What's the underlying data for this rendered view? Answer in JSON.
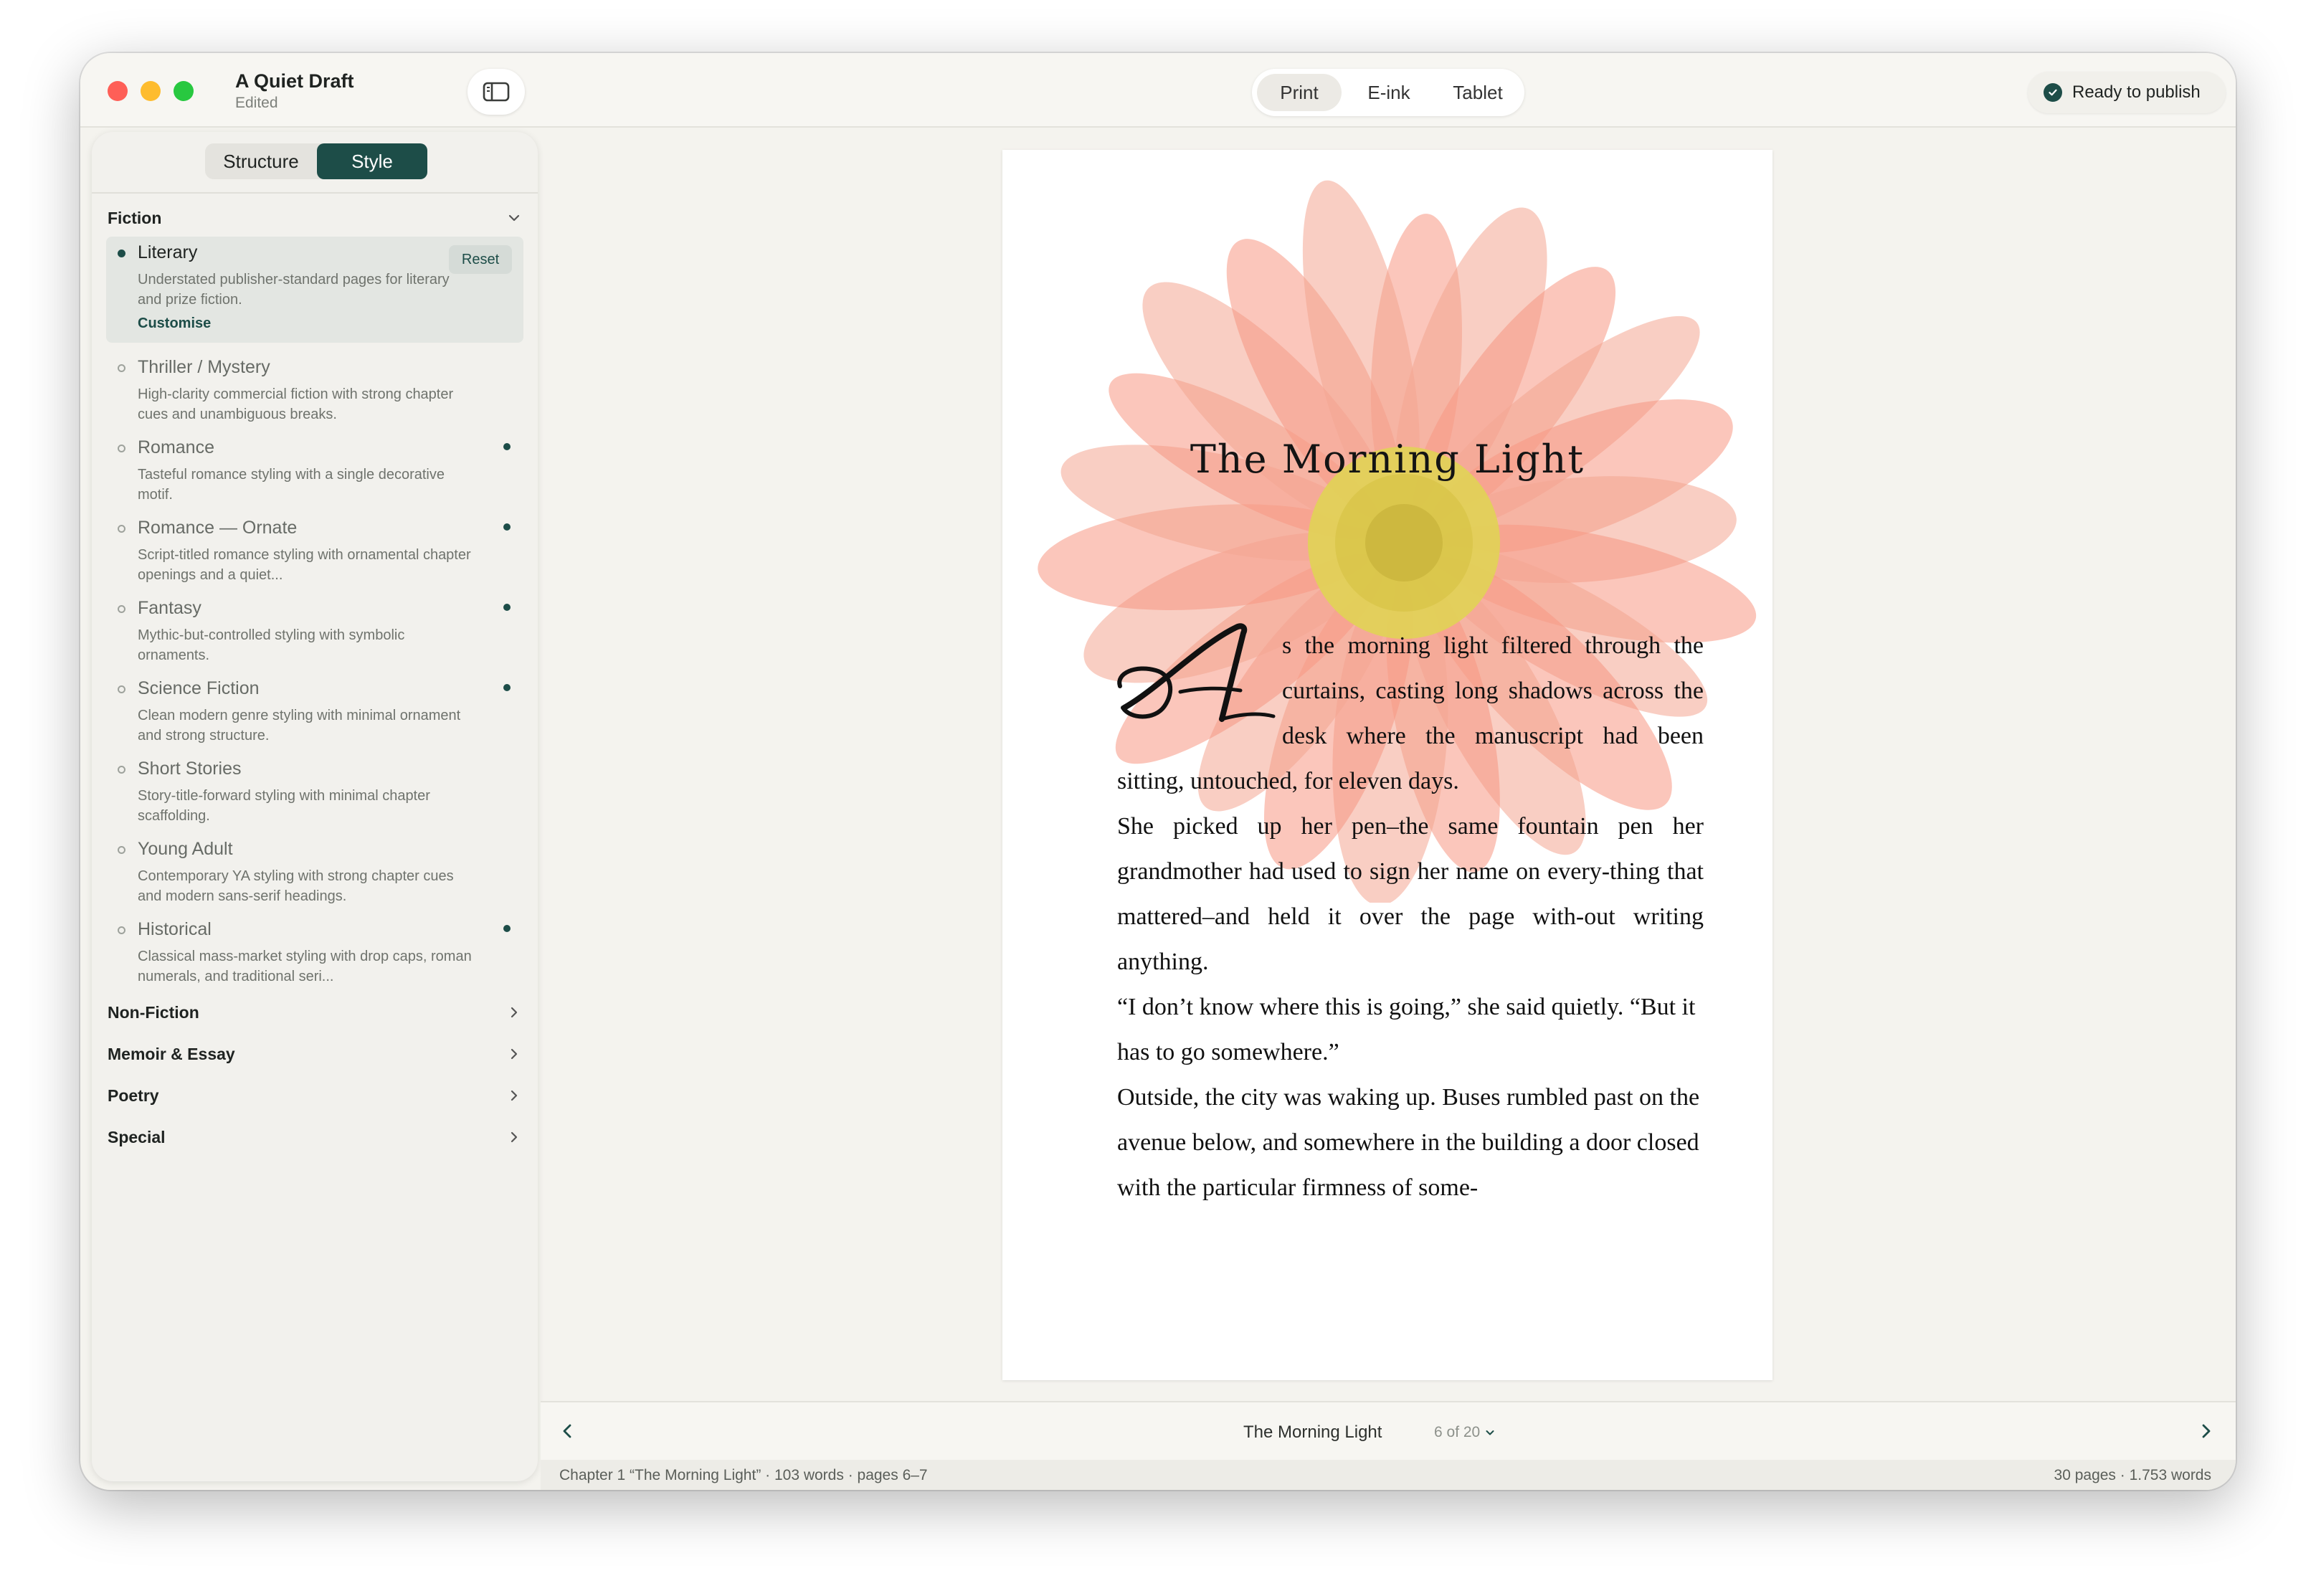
{
  "window": {
    "doc_title": "A Quiet Draft",
    "doc_status": "Edited",
    "view_modes": [
      "Print",
      "E-ink",
      "Tablet"
    ],
    "active_view": "Print",
    "publish_label": "Ready to publish"
  },
  "sidebar": {
    "tabs": [
      "Structure",
      "Style"
    ],
    "active_tab": "Style",
    "categories": {
      "fiction": "Fiction",
      "non_fiction": "Non-Fiction",
      "memoir": "Memoir & Essay",
      "poetry": "Poetry",
      "special": "Special"
    },
    "selected_actions": {
      "reset": "Reset",
      "customise": "Customise"
    },
    "fiction_styles": [
      {
        "name": "Literary",
        "desc": "Understated publisher-standard pages for literary and prize fiction."
      },
      {
        "name": "Thriller / Mystery",
        "desc": "High-clarity commercial fiction with strong chapter cues and unambiguous breaks."
      },
      {
        "name": "Romance",
        "desc": "Tasteful romance styling with a single decorative motif."
      },
      {
        "name": "Romance — Ornate",
        "desc": "Script-titled romance styling with ornamental chapter openings and a quiet..."
      },
      {
        "name": "Fantasy",
        "desc": "Mythic-but-controlled styling with symbolic ornaments."
      },
      {
        "name": "Science Fiction",
        "desc": "Clean modern genre styling with minimal ornament and strong structure."
      },
      {
        "name": "Short Stories",
        "desc": "Story-title-forward styling with minimal chapter scaffolding."
      },
      {
        "name": "Young Adult",
        "desc": "Contemporary YA styling with strong chapter cues and modern sans-serif headings."
      },
      {
        "name": "Historical",
        "desc": "Classical mass-market styling with drop caps, roman numerals, and traditional seri..."
      }
    ]
  },
  "page": {
    "title": "The Morning Light",
    "drop_cap": "A",
    "paragraphs": [
      "s the morning light filtered through the curtains, casting long shadows across the desk where the manuscript had been sitting, untouched, for eleven days.",
      "She picked up her pen–the same fountain pen her grandmother had used to sign her name on every-thing that mattered–and held it over the page with-out writing anything.",
      "“I don’t know where this is going,” she said quietly. “But it has to go somewhere.”",
      "Outside, the city was waking up. Buses rumbled past on the avenue below, and somewhere in the building a door closed with the particular firmness of some-"
    ]
  },
  "nav": {
    "chapter_title": "The Morning Light",
    "page_indicator": "6 of 20"
  },
  "status": {
    "left": "Chapter 1 “The Morning Light”  ·  103 words  ·  pages 6–7",
    "right": "30 pages  ·  1.753 words"
  },
  "colors": {
    "accent": "#1d4d48",
    "window_bg": "#f4f3ee",
    "flower_petal": "#f4856a",
    "flower_center": "#e2d158"
  }
}
